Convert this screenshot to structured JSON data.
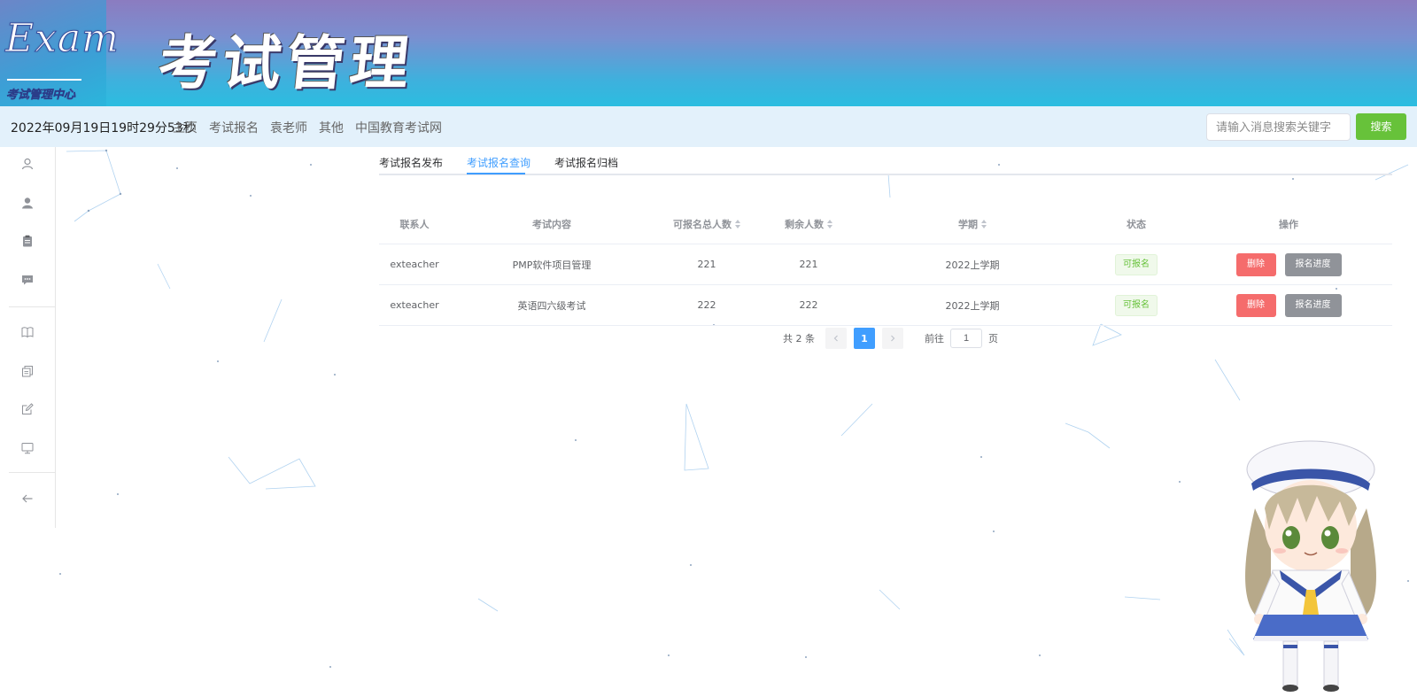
{
  "banner": {
    "logo_word": "Exam",
    "logo_subtitle": "考试管理中心",
    "title": "考试管理"
  },
  "navbar": {
    "clock": "2022年09月19日19时29分53秒",
    "links": [
      "主页",
      "考试报名",
      "袁老师",
      "其他",
      "中国教育考试网"
    ],
    "search_placeholder": "请输入消息搜索关键字",
    "search_button": "搜索"
  },
  "sidebar": {
    "icons": [
      "user-outline-icon",
      "user-filled-icon",
      "clipboard-icon",
      "chat-icon",
      "book-icon",
      "copy-icon",
      "edit-icon",
      "monitor-icon",
      "back-arrow-icon"
    ]
  },
  "tabs": [
    "考试报名发布",
    "考试报名查询",
    "考试报名归档"
  ],
  "active_tab": 1,
  "table": {
    "headers": {
      "contact": "联系人",
      "content": "考试内容",
      "total": "可报名总人数",
      "remaining": "剩余人数",
      "term": "学期",
      "status": "状态",
      "actions": "操作"
    },
    "rows": [
      {
        "contact": "exteacher",
        "content": "PMP软件项目管理",
        "total": "221",
        "remaining": "221",
        "term": "2022上学期",
        "status": "可报名",
        "delete": "删除",
        "progress": "报名进度"
      },
      {
        "contact": "exteacher",
        "content": "英语四六级考试",
        "total": "222",
        "remaining": "222",
        "term": "2022上学期",
        "status": "可报名",
        "delete": "删除",
        "progress": "报名进度"
      }
    ]
  },
  "pagination": {
    "total_text": "共 2 条",
    "current_page": "1",
    "goto_label": "前往",
    "goto_value": "1",
    "page_suffix": "页"
  },
  "colors": {
    "accent": "#409eff",
    "success": "#67c23a",
    "danger": "#f56c6c",
    "info": "#909399"
  }
}
